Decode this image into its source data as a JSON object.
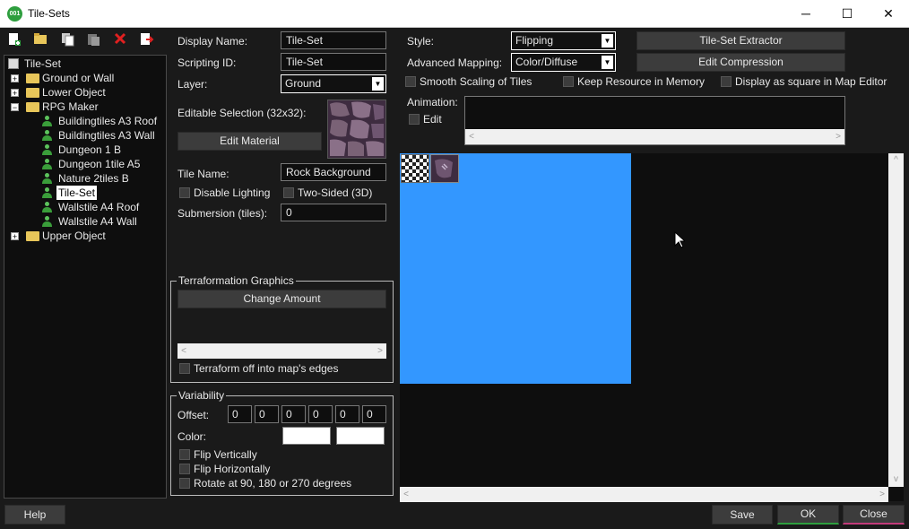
{
  "window": {
    "title": "Tile-Sets",
    "icon_text": "001",
    "minimize": "─",
    "maximize": "☐",
    "close": "✕"
  },
  "toolbar": {
    "icons": [
      "new-icon",
      "open-folder-icon",
      "copy-icon",
      "paste-icon",
      "delete-icon",
      "export-icon"
    ]
  },
  "tree": {
    "root": "Tile-Set",
    "items": [
      {
        "label": "Ground or Wall",
        "type": "folder",
        "expander": "+"
      },
      {
        "label": "Lower Object",
        "type": "folder",
        "expander": "+"
      },
      {
        "label": "RPG Maker",
        "type": "folder",
        "expander": "−"
      },
      {
        "label": "Buildingtiles A3 Roof",
        "type": "leaf"
      },
      {
        "label": "Buildingtiles A3 Wall",
        "type": "leaf"
      },
      {
        "label": "Dungeon 1 B",
        "type": "leaf"
      },
      {
        "label": "Dungeon 1tile A5",
        "type": "leaf"
      },
      {
        "label": "Nature 2tiles B",
        "type": "leaf"
      },
      {
        "label": "Tile-Set",
        "type": "leaf",
        "selected": true
      },
      {
        "label": "Wallstile A4 Roof",
        "type": "leaf"
      },
      {
        "label": "Wallstile A4 Wall",
        "type": "leaf"
      },
      {
        "label": "Upper Object",
        "type": "folder",
        "expander": "+"
      }
    ]
  },
  "form": {
    "display_name_label": "Display Name:",
    "display_name": "Tile-Set",
    "scripting_id_label": "Scripting ID:",
    "scripting_id": "Tile-Set",
    "layer_label": "Layer:",
    "layer": "Ground",
    "editable_selection_label": "Editable Selection (32x32):",
    "edit_material": "Edit Material",
    "tile_name_label": "Tile Name:",
    "tile_name": "Rock Background",
    "disable_lighting": "Disable Lighting",
    "two_sided": "Two-Sided (3D)",
    "submersion_label": "Submersion (tiles):",
    "submersion": "0"
  },
  "terraformation": {
    "title": "Terraformation Graphics",
    "change_amount": "Change Amount",
    "terraform_edges": "Terraform off into map's edges"
  },
  "variability": {
    "title": "Variability",
    "offset_label": "Offset:",
    "offsets": [
      "0",
      "0",
      "0",
      "0",
      "0",
      "0"
    ],
    "color_label": "Color:",
    "flip_vertically": "Flip Vertically",
    "flip_horizontally": "Flip Horizontally",
    "rotate": "Rotate at 90, 180 or 270 degrees"
  },
  "right": {
    "style_label": "Style:",
    "style": "Flipping",
    "advanced_mapping_label": "Advanced Mapping:",
    "advanced_mapping": "Color/Diffuse",
    "extractor": "Tile-Set Extractor",
    "edit_compression": "Edit Compression",
    "smooth_scaling": "Smooth Scaling of Tiles",
    "keep_resource": "Keep Resource in Memory",
    "display_square": "Display as square in Map Editor",
    "animation_label": "Animation:",
    "animation_edit": "Edit"
  },
  "footer": {
    "help": "Help",
    "save": "Save",
    "ok": "OK",
    "close": "Close"
  },
  "colors": {
    "canvas_blue": "#3397ff",
    "ok_accent": "#2e9e3e",
    "close_accent": "#c23b7a"
  }
}
